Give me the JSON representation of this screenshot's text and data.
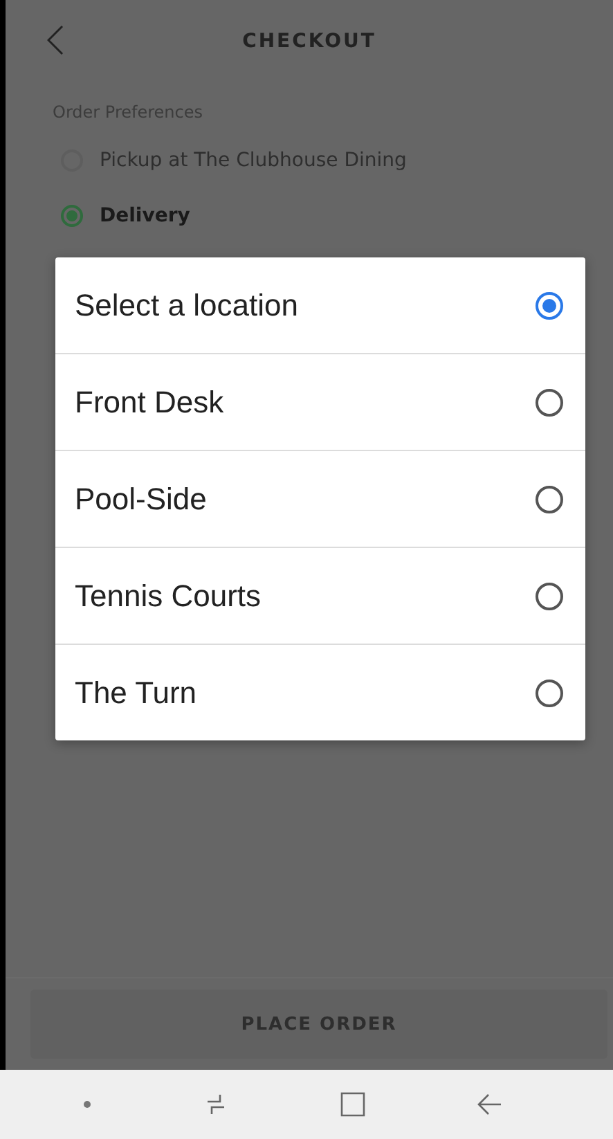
{
  "header": {
    "title": "CHECKOUT"
  },
  "order_preferences": {
    "label": "Order Preferences",
    "options": [
      {
        "label": "Pickup at The Clubhouse Dining",
        "selected": false
      },
      {
        "label": "Delivery",
        "selected": true
      }
    ]
  },
  "location_dialog": {
    "options": [
      {
        "label": "Select a location",
        "selected": true
      },
      {
        "label": "Front Desk",
        "selected": false
      },
      {
        "label": "Pool-Side",
        "selected": false
      },
      {
        "label": "Tennis Courts",
        "selected": false
      },
      {
        "label": "The Turn",
        "selected": false
      }
    ]
  },
  "place_order_button": {
    "label": "PLACE ORDER",
    "disabled": true
  }
}
